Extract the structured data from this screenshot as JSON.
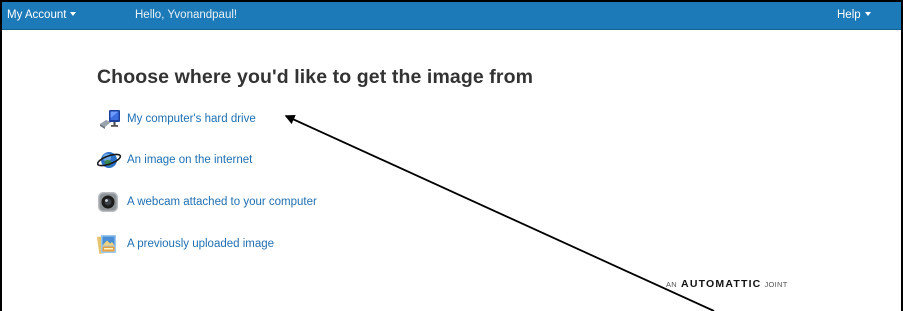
{
  "topbar": {
    "account_label": "My Account",
    "greeting": "Hello, Yvonandpaul!",
    "help_label": "Help",
    "bg_color": "#1d7ab8"
  },
  "main": {
    "heading": "Choose where you'd like to get the image from",
    "options": [
      {
        "label": "My computer's hard drive",
        "icon": "hard-drive-icon"
      },
      {
        "label": "An image on the internet",
        "icon": "globe-icon"
      },
      {
        "label": "A webcam attached to your computer",
        "icon": "webcam-icon"
      },
      {
        "label": "A previously uploaded image",
        "icon": "uploaded-image-icon"
      }
    ],
    "link_color": "#1f6fb3"
  },
  "footer": {
    "brand_prefix": "AN",
    "brand_name": "AUTOMATTIC",
    "brand_suffix": "JOINT"
  },
  "annotation": {
    "arrow_color": "#000000"
  }
}
